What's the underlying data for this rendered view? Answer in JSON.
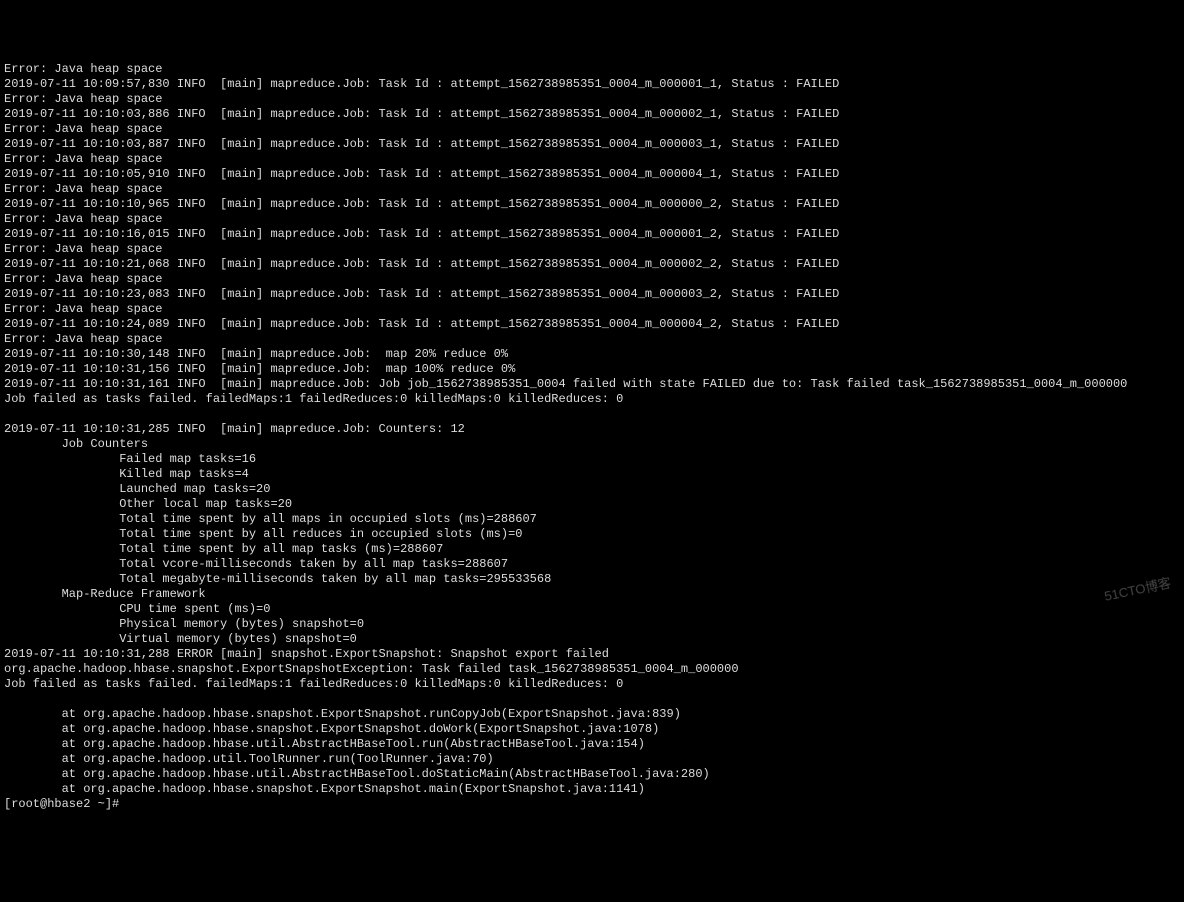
{
  "lines": [
    "Error: Java heap space",
    "2019-07-11 10:09:57,830 INFO  [main] mapreduce.Job: Task Id : attempt_1562738985351_0004_m_000001_1, Status : FAILED",
    "Error: Java heap space",
    "2019-07-11 10:10:03,886 INFO  [main] mapreduce.Job: Task Id : attempt_1562738985351_0004_m_000002_1, Status : FAILED",
    "Error: Java heap space",
    "2019-07-11 10:10:03,887 INFO  [main] mapreduce.Job: Task Id : attempt_1562738985351_0004_m_000003_1, Status : FAILED",
    "Error: Java heap space",
    "2019-07-11 10:10:05,910 INFO  [main] mapreduce.Job: Task Id : attempt_1562738985351_0004_m_000004_1, Status : FAILED",
    "Error: Java heap space",
    "2019-07-11 10:10:10,965 INFO  [main] mapreduce.Job: Task Id : attempt_1562738985351_0004_m_000000_2, Status : FAILED",
    "Error: Java heap space",
    "2019-07-11 10:10:16,015 INFO  [main] mapreduce.Job: Task Id : attempt_1562738985351_0004_m_000001_2, Status : FAILED",
    "Error: Java heap space",
    "2019-07-11 10:10:21,068 INFO  [main] mapreduce.Job: Task Id : attempt_1562738985351_0004_m_000002_2, Status : FAILED",
    "Error: Java heap space",
    "2019-07-11 10:10:23,083 INFO  [main] mapreduce.Job: Task Id : attempt_1562738985351_0004_m_000003_2, Status : FAILED",
    "Error: Java heap space",
    "2019-07-11 10:10:24,089 INFO  [main] mapreduce.Job: Task Id : attempt_1562738985351_0004_m_000004_2, Status : FAILED",
    "Error: Java heap space",
    "2019-07-11 10:10:30,148 INFO  [main] mapreduce.Job:  map 20% reduce 0%",
    "2019-07-11 10:10:31,156 INFO  [main] mapreduce.Job:  map 100% reduce 0%",
    "2019-07-11 10:10:31,161 INFO  [main] mapreduce.Job: Job job_1562738985351_0004 failed with state FAILED due to: Task failed task_1562738985351_0004_m_000000",
    "Job failed as tasks failed. failedMaps:1 failedReduces:0 killedMaps:0 killedReduces: 0",
    "",
    "2019-07-11 10:10:31,285 INFO  [main] mapreduce.Job: Counters: 12",
    "        Job Counters",
    "                Failed map tasks=16",
    "                Killed map tasks=4",
    "                Launched map tasks=20",
    "                Other local map tasks=20",
    "                Total time spent by all maps in occupied slots (ms)=288607",
    "                Total time spent by all reduces in occupied slots (ms)=0",
    "                Total time spent by all map tasks (ms)=288607",
    "                Total vcore-milliseconds taken by all map tasks=288607",
    "                Total megabyte-milliseconds taken by all map tasks=295533568",
    "        Map-Reduce Framework",
    "                CPU time spent (ms)=0",
    "                Physical memory (bytes) snapshot=0",
    "                Virtual memory (bytes) snapshot=0",
    "2019-07-11 10:10:31,288 ERROR [main] snapshot.ExportSnapshot: Snapshot export failed",
    "org.apache.hadoop.hbase.snapshot.ExportSnapshotException: Task failed task_1562738985351_0004_m_000000",
    "Job failed as tasks failed. failedMaps:1 failedReduces:0 killedMaps:0 killedReduces: 0",
    "",
    "        at org.apache.hadoop.hbase.snapshot.ExportSnapshot.runCopyJob(ExportSnapshot.java:839)",
    "        at org.apache.hadoop.hbase.snapshot.ExportSnapshot.doWork(ExportSnapshot.java:1078)",
    "        at org.apache.hadoop.hbase.util.AbstractHBaseTool.run(AbstractHBaseTool.java:154)",
    "        at org.apache.hadoop.util.ToolRunner.run(ToolRunner.java:70)",
    "        at org.apache.hadoop.hbase.util.AbstractHBaseTool.doStaticMain(AbstractHBaseTool.java:280)",
    "        at org.apache.hadoop.hbase.snapshot.ExportSnapshot.main(ExportSnapshot.java:1141)",
    "[root@hbase2 ~]#"
  ],
  "watermark": "51CTO博客"
}
